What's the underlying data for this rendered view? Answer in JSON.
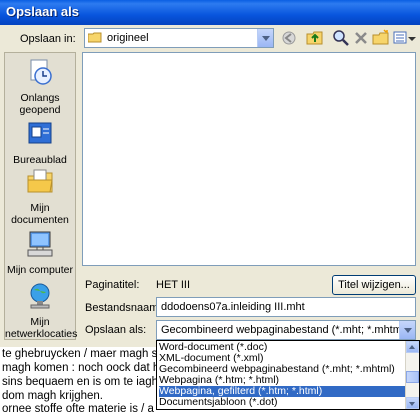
{
  "window": {
    "title": "Opslaan als"
  },
  "savein": {
    "label": "Opslaan in:",
    "folder": "origineel"
  },
  "toolbar": {
    "icons": [
      "back-icon",
      "up-folder-icon",
      "search-web-icon",
      "delete-icon",
      "new-folder-icon",
      "views-icon",
      "tools-icon"
    ]
  },
  "places": [
    {
      "id": "recent",
      "label": "Onlangs geopend",
      "icon": "recent-documents-icon"
    },
    {
      "id": "desktop",
      "label": "Bureaublad",
      "icon": "desktop-icon"
    },
    {
      "id": "documents",
      "label": "Mijn documenten",
      "icon": "my-documents-icon"
    },
    {
      "id": "computer",
      "label": "Mijn computer",
      "icon": "my-computer-icon"
    },
    {
      "id": "network",
      "label": "Mijn netwerklocaties",
      "icon": "network-places-icon"
    }
  ],
  "form": {
    "pagetitle_label": "Paginatitel:",
    "pagetitle_value": "HET III",
    "change_title_button": "Titel wijzigen...",
    "filename_label": "Bestandsnaam:",
    "filename_value": "ddodoens07a.inleiding III.mht",
    "saveas_label": "Opslaan als:",
    "saveas_value": "Gecombineerd webpaginabestand (*.mht; *.mhtml)"
  },
  "dropdown": {
    "options": [
      "Word-document (*.doc)",
      "XML-document (*.xml)",
      "Gecombineerd webpaginabestand (*.mht; *.mhtml)",
      "Webpagina (*.htm; *.html)",
      "Webpagina, gefilterd (*.htm; *.html)",
      "Documentsjabloon (*.dot)"
    ],
    "selected_index": 4
  },
  "background_document": {
    "lines": [
      "te ghebruycken / maer magh s",
      "magh komen : noch oock dat h",
      "sins bequaem en is om te iagh",
      "dom magh krijghen.",
      "ornee stoffe ofte materie is / a"
    ]
  },
  "colors": {
    "titlebar": "#0a5fe3",
    "selection": "#316ac5",
    "dialog_bg": "#ece9d8"
  }
}
